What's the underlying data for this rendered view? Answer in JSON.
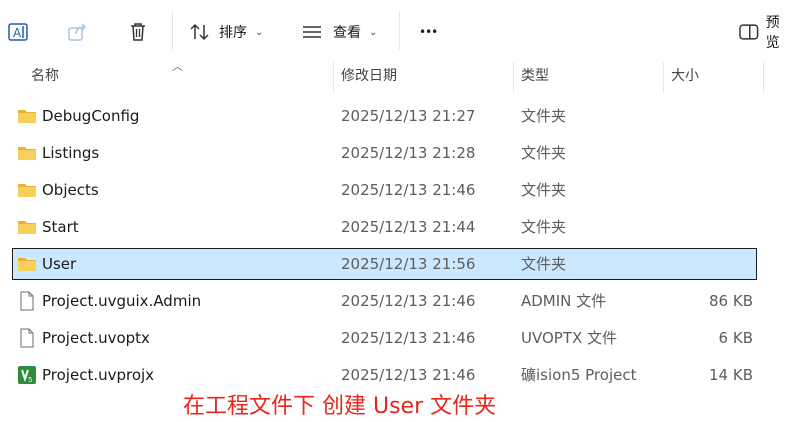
{
  "toolbar": {
    "sort_label": "排序",
    "view_label": "查看",
    "more_label": "•••",
    "preview_label": "预览"
  },
  "columns": {
    "name": "名称",
    "date": "修改日期",
    "type": "类型",
    "size": "大小"
  },
  "rows": [
    {
      "name": "DebugConfig",
      "date": "2025/12/13 21:27",
      "type": "文件夹",
      "size": "",
      "icon": "folder-icon"
    },
    {
      "name": "Listings",
      "date": "2025/12/13 21:28",
      "type": "文件夹",
      "size": "",
      "icon": "folder-icon"
    },
    {
      "name": "Objects",
      "date": "2025/12/13 21:46",
      "type": "文件夹",
      "size": "",
      "icon": "folder-icon"
    },
    {
      "name": "Start",
      "date": "2025/12/13 21:44",
      "type": "文件夹",
      "size": "",
      "icon": "folder-icon"
    },
    {
      "name": "User",
      "date": "2025/12/13 21:56",
      "type": "文件夹",
      "size": "",
      "icon": "folder-icon",
      "selected": true
    },
    {
      "name": "Project.uvguix.Admin",
      "date": "2025/12/13 21:46",
      "type": "ADMIN 文件",
      "size": "86 KB",
      "icon": "file-icon"
    },
    {
      "name": "Project.uvoptx",
      "date": "2025/12/13 21:46",
      "type": "UVOPTX 文件",
      "size": "6 KB",
      "icon": "file-icon"
    },
    {
      "name": "Project.uvprojx",
      "date": "2025/12/13 21:46",
      "type": "礦ision5 Project",
      "size": "14 KB",
      "icon": "keil-project-icon"
    }
  ],
  "annotation": "在工程文件下 创建 User 文件夹",
  "colors": {
    "selection": "#cce8ff",
    "folder": "#f4c542",
    "annotation": "#e8261b",
    "keil_green": "#2e8b3a"
  }
}
